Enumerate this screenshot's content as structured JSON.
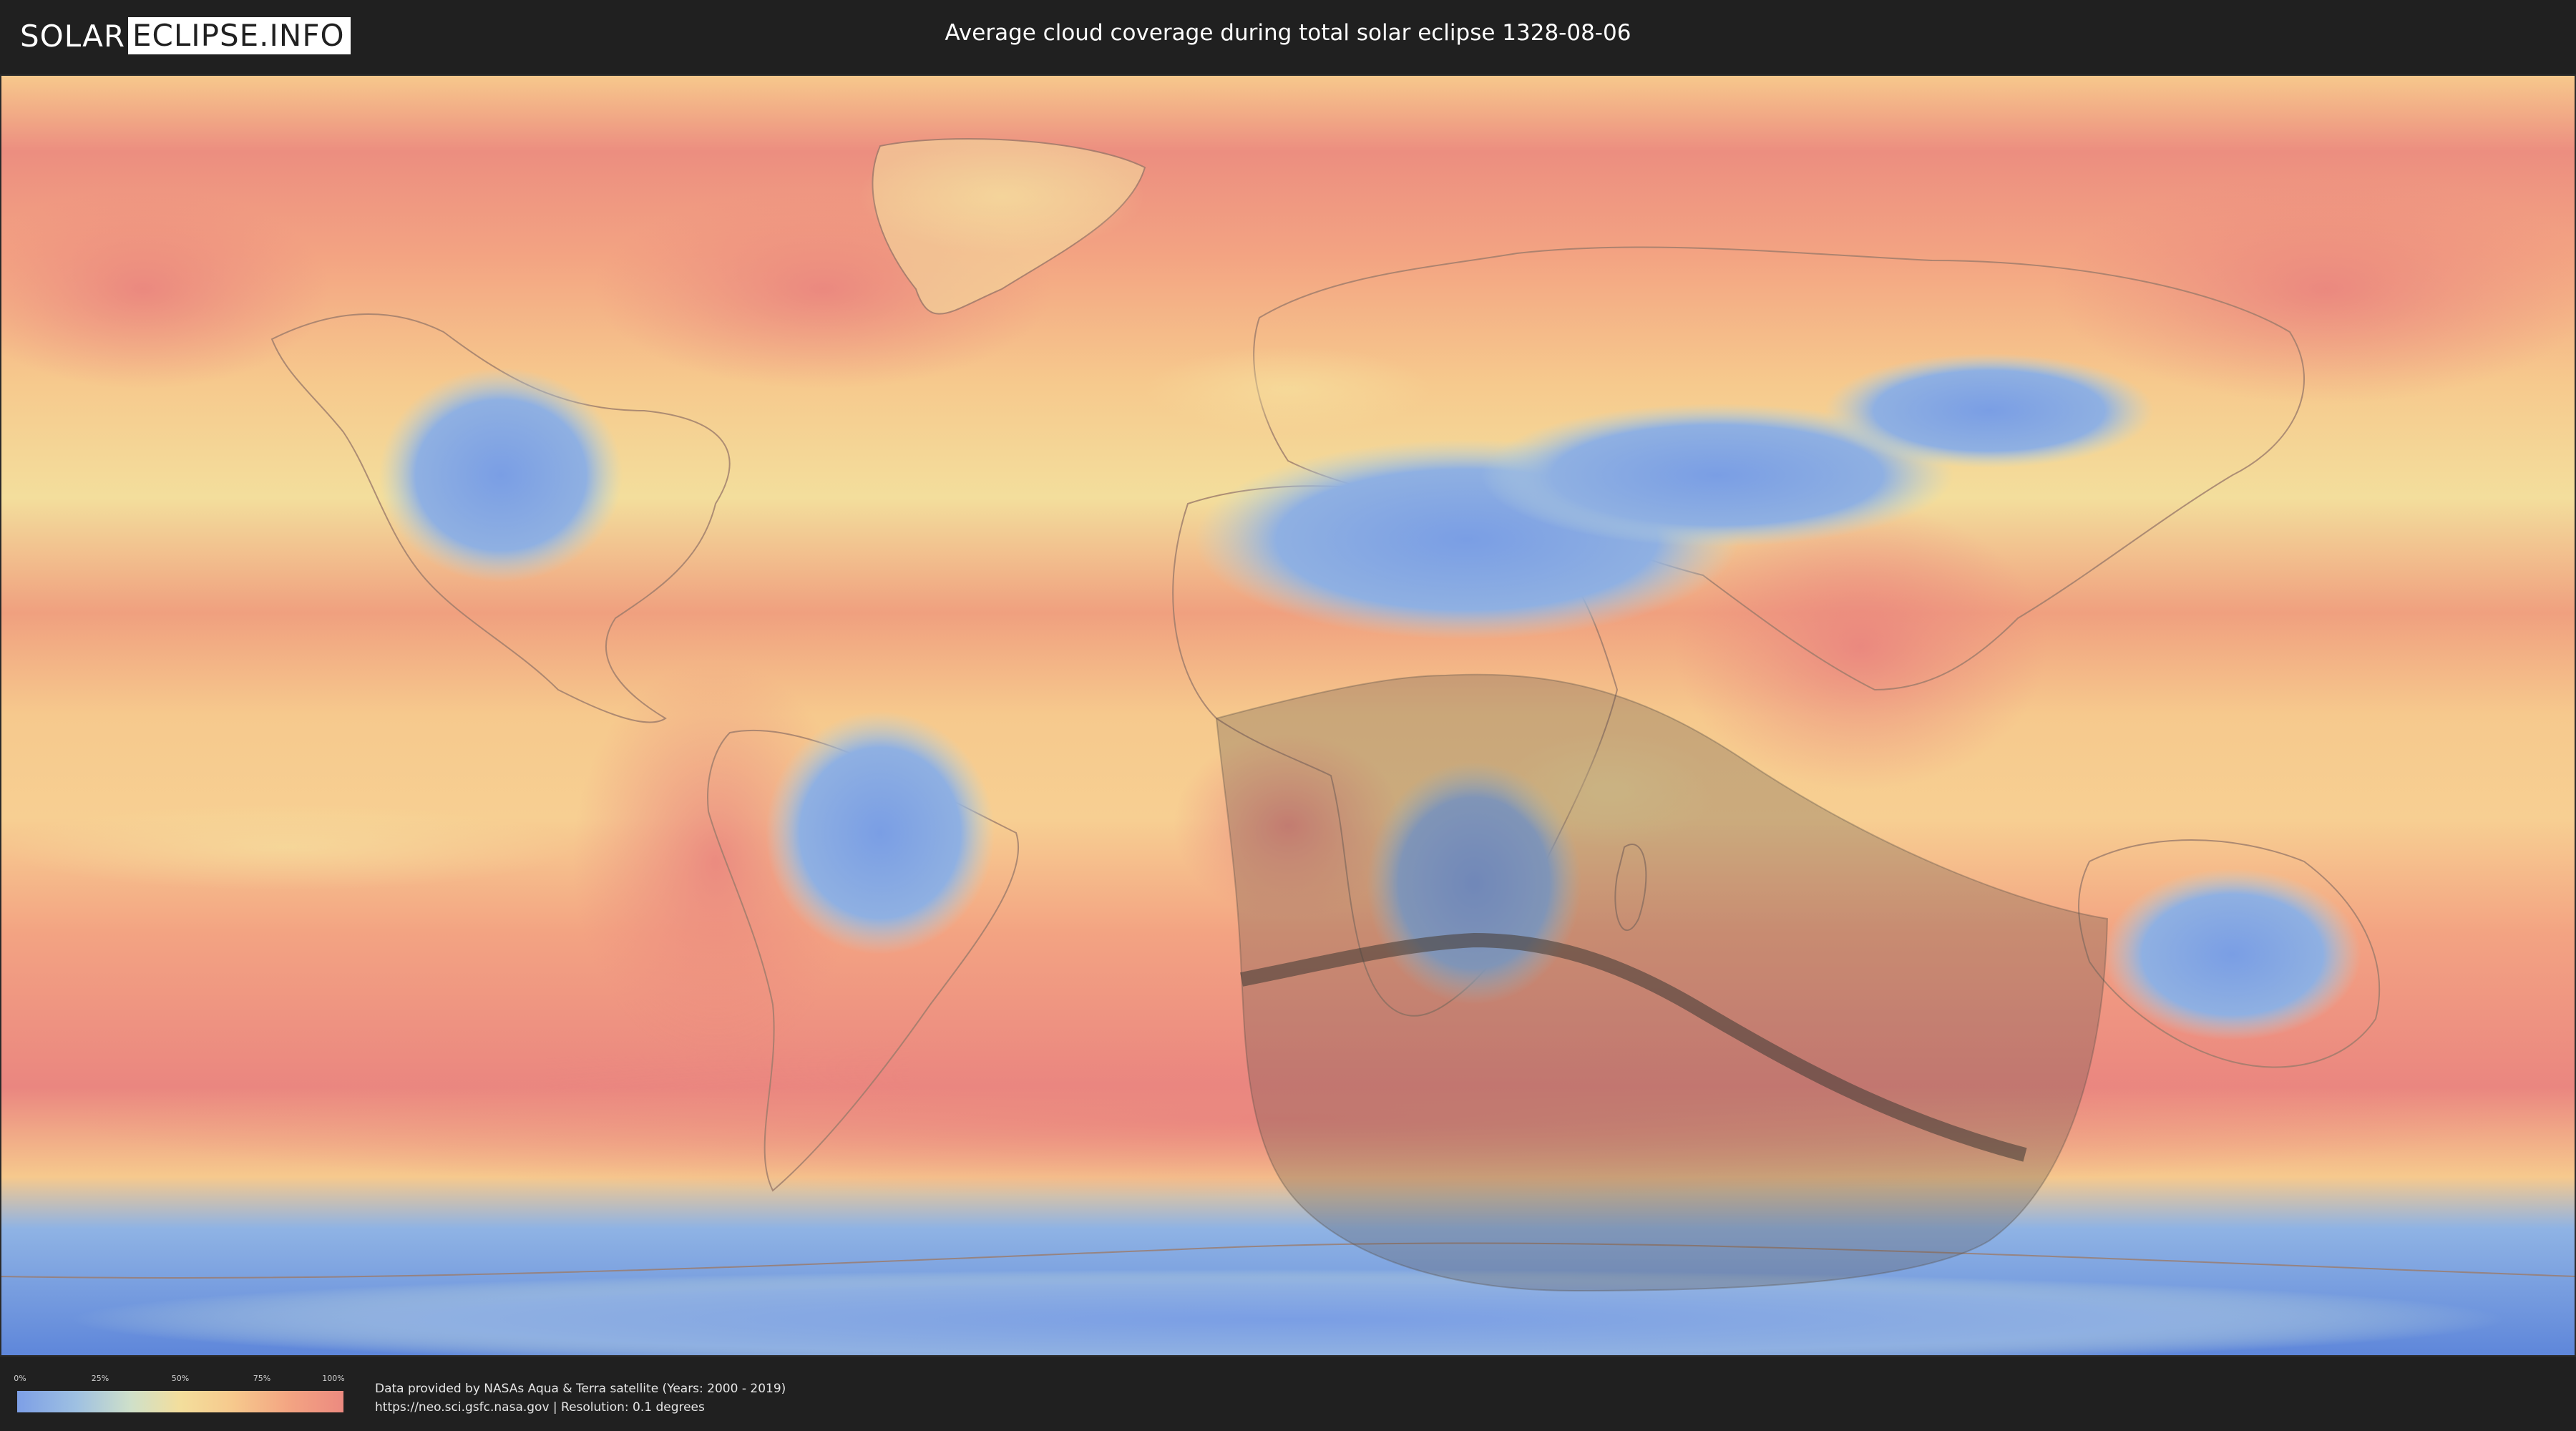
{
  "header": {
    "logo_left": "SOLAR",
    "logo_right": "ECLIPSE.INFO",
    "title": "Average cloud coverage during total solar eclipse 1328-08-06"
  },
  "legend": {
    "ticks": [
      "0%",
      "25%",
      "50%",
      "75%",
      "100%"
    ],
    "colors": [
      "#7d9fe6",
      "#cfe0c9",
      "#f3de9c",
      "#f3a382",
      "#ec8a80"
    ]
  },
  "credits": {
    "line1": "Data provided by NASAs Aqua & Terra satellite (Years: 2000 - 2019)",
    "line2": "https://neo.sci.gsfc.nasa.gov | Resolution: 0.1 degrees"
  },
  "map": {
    "colors": {
      "ocean": "#f4b088",
      "high_cloud": "#ec8a80",
      "mid_cloud": "#f6c98d",
      "low_cloud": "#7da2e0",
      "shadow": "#5a5048",
      "central_line": "#4a4038",
      "antarctica": "#7fa6e8"
    }
  }
}
